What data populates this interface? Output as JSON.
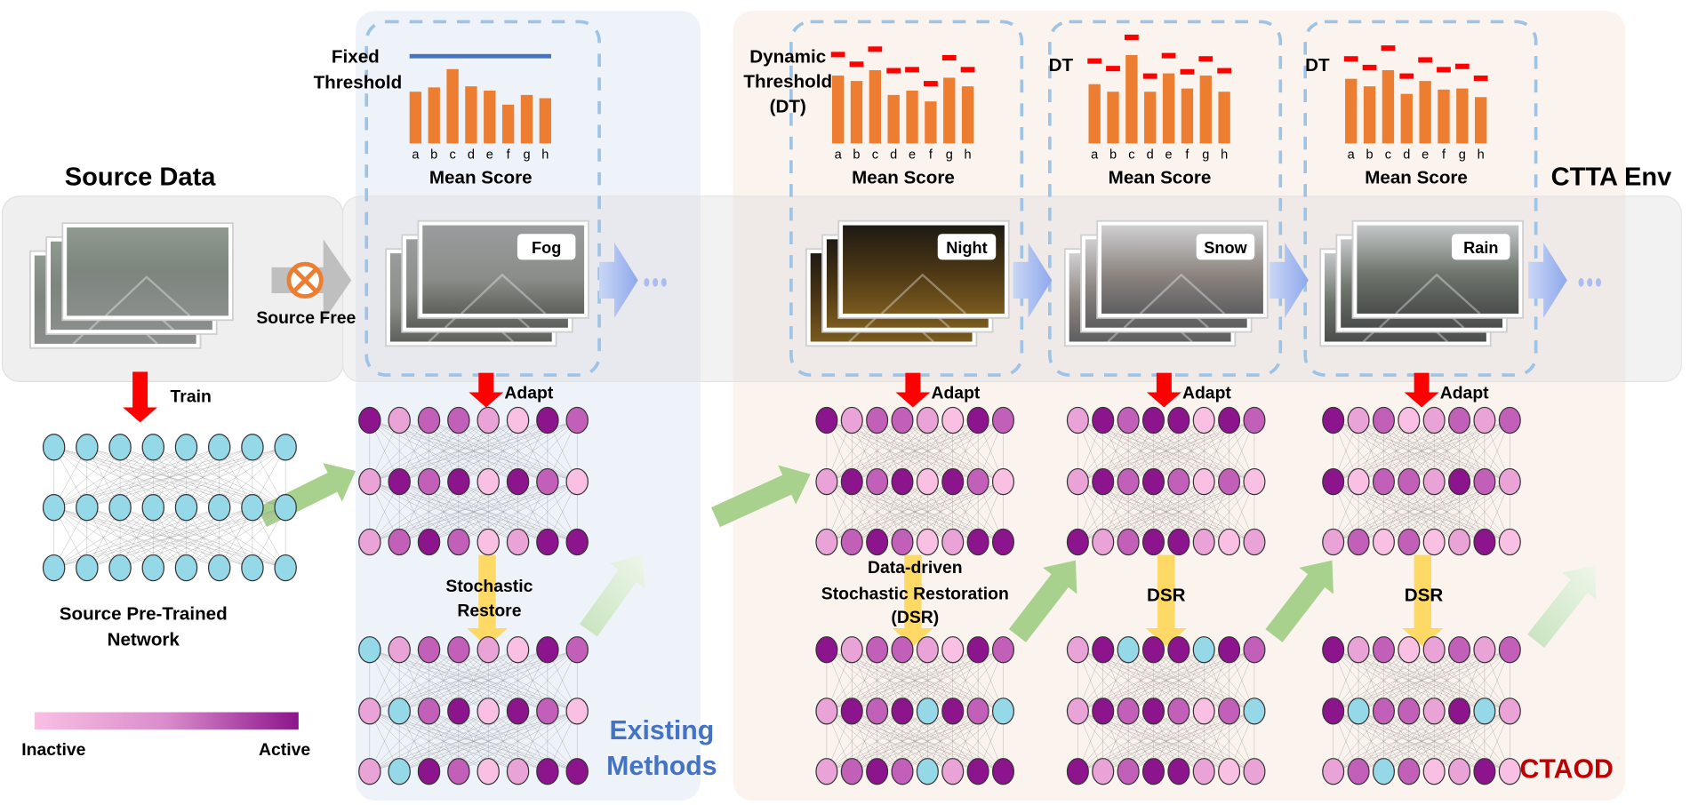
{
  "colors": {
    "inactive": "#f9c0e3",
    "level2": "#e9a3d6",
    "level3": "#c25fb8",
    "active": "#8c148c",
    "source_neuron": "#95d8e8",
    "bar": "#ed7d31",
    "fixed_threshold": "#4472c4",
    "dynamic_threshold": "#ff0000",
    "existing_methods": "#4472c4",
    "ctaod": "#c00000"
  },
  "source": {
    "title": "Source Data",
    "source_free_label": "Source Free",
    "train_label": "Train",
    "network_label_line1": "Source Pre-Trained",
    "network_label_line2": "Network"
  },
  "legend": {
    "inactive": "Inactive",
    "active": "Active"
  },
  "env_label": "CTTA Env",
  "existing": {
    "title_line1": "Existing",
    "title_line2": "Methods",
    "threshold_line1": "Fixed",
    "threshold_line2": "Threshold",
    "chart_title": "Mean Score",
    "domain": "Fog",
    "adapt_label": "Adapt",
    "restore_line1": "Stochastic",
    "restore_line2": "Restore"
  },
  "ctaod": {
    "title": "CTAOD",
    "threshold_line1": "Dynamic",
    "threshold_line2": "Threshold",
    "threshold_line3": "(DT)",
    "dt_label": "DT",
    "chart_title": "Mean Score",
    "domains": [
      "Night",
      "Snow",
      "Rain"
    ],
    "adapt_label": "Adapt",
    "dsr_line1": "Data-driven",
    "dsr_line2": "Stochastic Restoration",
    "dsr_line3": "(DSR)",
    "dsr_short": "DSR"
  },
  "chart_data": [
    {
      "type": "bar",
      "title": "Mean Score",
      "categories": [
        "a",
        "b",
        "c",
        "d",
        "e",
        "f",
        "g",
        "h"
      ],
      "values": [
        48,
        52,
        69,
        53,
        49,
        36,
        45,
        42
      ],
      "fixed_threshold": 81
    },
    {
      "type": "bar",
      "title": "Mean Score",
      "categories": [
        "a",
        "b",
        "c",
        "d",
        "e",
        "f",
        "g",
        "h"
      ],
      "values": [
        63,
        58,
        68,
        45,
        49,
        39,
        61,
        53
      ],
      "thresholds": [
        82,
        73,
        87,
        67,
        68,
        55,
        79,
        68
      ]
    },
    {
      "type": "bar",
      "title": "Mean Score",
      "categories": [
        "a",
        "b",
        "c",
        "d",
        "e",
        "f",
        "g",
        "h"
      ],
      "values": [
        55,
        48,
        82,
        48,
        65,
        51,
        63,
        48
      ],
      "thresholds": [
        76,
        69,
        98,
        62,
        81,
        66,
        78,
        67
      ]
    },
    {
      "type": "bar",
      "title": "Mean Score",
      "categories": [
        "a",
        "b",
        "c",
        "d",
        "e",
        "f",
        "g",
        "h"
      ],
      "values": [
        60,
        53,
        68,
        46,
        58,
        50,
        51,
        43
      ],
      "thresholds": [
        78,
        70,
        88,
        62,
        77,
        68,
        71,
        60
      ]
    }
  ],
  "networks": {
    "source": [
      [
        0,
        0,
        0,
        0,
        0,
        0,
        0,
        0
      ],
      [
        0,
        0,
        0,
        0,
        0,
        0,
        0,
        0
      ],
      [
        0,
        0,
        0,
        0,
        0,
        0,
        0,
        0
      ]
    ],
    "existing_adapted": [
      [
        4,
        2,
        3,
        3,
        2,
        1,
        4,
        3
      ],
      [
        2,
        4,
        3,
        4,
        1,
        4,
        3,
        1
      ],
      [
        2,
        3,
        4,
        3,
        1,
        2,
        4,
        4
      ]
    ],
    "existing_restored": [
      [
        0,
        2,
        3,
        3,
        2,
        1,
        4,
        3
      ],
      [
        2,
        0,
        3,
        4,
        1,
        4,
        3,
        1
      ],
      [
        2,
        0,
        4,
        3,
        1,
        2,
        4,
        4
      ]
    ],
    "ctaod1_adapted": [
      [
        4,
        2,
        3,
        3,
        2,
        1,
        4,
        3
      ],
      [
        2,
        4,
        3,
        4,
        1,
        4,
        3,
        1
      ],
      [
        2,
        3,
        4,
        3,
        1,
        2,
        4,
        4
      ]
    ],
    "ctaod1_restored": [
      [
        4,
        2,
        3,
        3,
        2,
        1,
        4,
        3
      ],
      [
        2,
        4,
        3,
        4,
        0,
        4,
        3,
        0
      ],
      [
        2,
        3,
        4,
        3,
        0,
        2,
        4,
        4
      ]
    ],
    "ctaod2_adapted": [
      [
        2,
        4,
        3,
        4,
        4,
        1,
        4,
        3
      ],
      [
        2,
        4,
        3,
        4,
        3,
        1,
        3,
        1
      ],
      [
        4,
        2,
        3,
        4,
        4,
        2,
        1,
        2
      ]
    ],
    "ctaod2_restored": [
      [
        2,
        4,
        0,
        4,
        4,
        0,
        4,
        3
      ],
      [
        2,
        4,
        3,
        4,
        3,
        1,
        3,
        0
      ],
      [
        4,
        2,
        3,
        4,
        4,
        2,
        1,
        2
      ]
    ],
    "ctaod3_adapted": [
      [
        4,
        2,
        3,
        1,
        2,
        3,
        2,
        3
      ],
      [
        4,
        1,
        3,
        3,
        2,
        4,
        3,
        2
      ],
      [
        2,
        3,
        1,
        3,
        1,
        2,
        4,
        1
      ]
    ],
    "ctaod3_restored": [
      [
        4,
        2,
        3,
        1,
        2,
        3,
        2,
        3
      ],
      [
        4,
        0,
        3,
        3,
        2,
        4,
        0,
        2
      ],
      [
        2,
        3,
        0,
        3,
        1,
        2,
        4,
        1
      ]
    ]
  }
}
